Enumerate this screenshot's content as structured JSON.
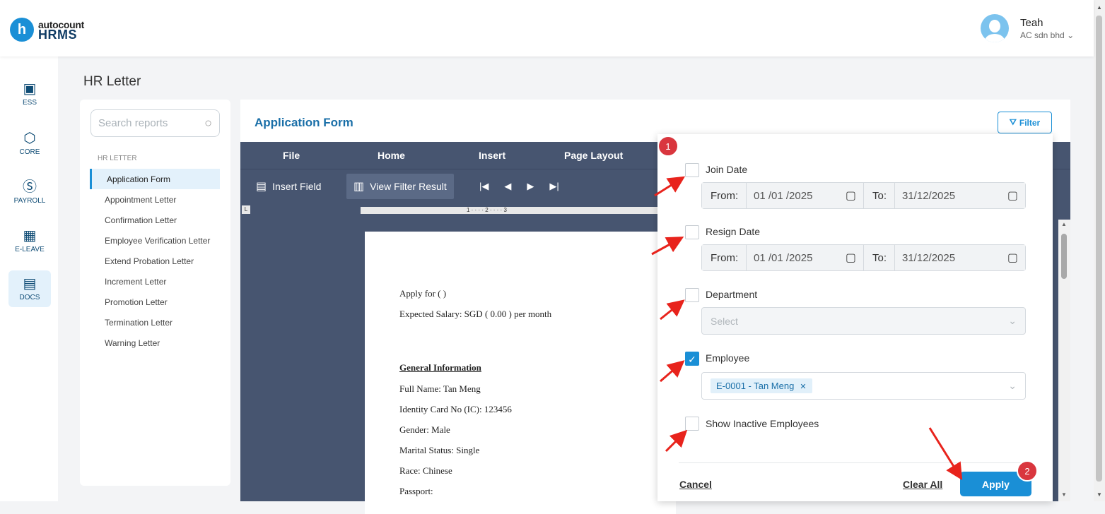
{
  "brand": {
    "top": "autocount",
    "bottom": "HRMS",
    "mark": "h"
  },
  "user": {
    "name": "Teah",
    "company": "AC sdn bhd"
  },
  "sidenav": [
    {
      "label": "ESS",
      "icon": "ess-icon"
    },
    {
      "label": "CORE",
      "icon": "core-icon"
    },
    {
      "label": "PAYROLL",
      "icon": "payroll-icon"
    },
    {
      "label": "E-LEAVE",
      "icon": "eleave-icon"
    },
    {
      "label": "DOCS",
      "icon": "docs-icon"
    }
  ],
  "page_title": "HR Letter",
  "search": {
    "placeholder": "Search reports"
  },
  "report_group": "HR LETTER",
  "reports": [
    "Application Form",
    "Appointment Letter",
    "Confirmation Letter",
    "Employee Verification Letter",
    "Extend Probation Letter",
    "Increment Letter",
    "Promotion Letter",
    "Termination Letter",
    "Warning Letter"
  ],
  "main": {
    "title": "Application Form",
    "filter_label": "Filter"
  },
  "menu": [
    "File",
    "Home",
    "Insert",
    "Page Layout"
  ],
  "toolbar": {
    "insert_field": "Insert Field",
    "view_filter": "View Filter Result"
  },
  "ruler": {
    "marks": "1 · · · · 2 · · · · 3"
  },
  "document": {
    "apply_for": "Apply for (  )",
    "expected_salary": "Expected Salary: SGD ( 0.00 ) per month",
    "section": "General Information",
    "full_name": "Full Name: Tan Meng",
    "ic": "Identity Card No (IC): 123456",
    "gender": "Gender: Male",
    "marital": "Marital Status: Single",
    "race": "Race: Chinese",
    "passport": "Passport:"
  },
  "filter": {
    "join_date": {
      "label": "Join Date",
      "from_label": "From:",
      "from": "01 /01 /2025",
      "to_label": "To:",
      "to": "31/12/2025",
      "checked": false
    },
    "resign_date": {
      "label": "Resign Date",
      "from_label": "From:",
      "from": "01 /01 /2025",
      "to_label": "To:",
      "to": "31/12/2025",
      "checked": false
    },
    "department": {
      "label": "Department",
      "placeholder": "Select",
      "checked": false
    },
    "employee": {
      "label": "Employee",
      "tag": "E-0001 - Tan Meng",
      "checked": true
    },
    "inactive": {
      "label": "Show Inactive Employees",
      "checked": false
    },
    "cancel": "Cancel",
    "clear_all": "Clear All",
    "apply": "Apply"
  },
  "badges": [
    "1",
    "2"
  ],
  "colors": {
    "accent": "#1a8fd6",
    "menubar": "#475570",
    "badge": "#d9363e"
  }
}
